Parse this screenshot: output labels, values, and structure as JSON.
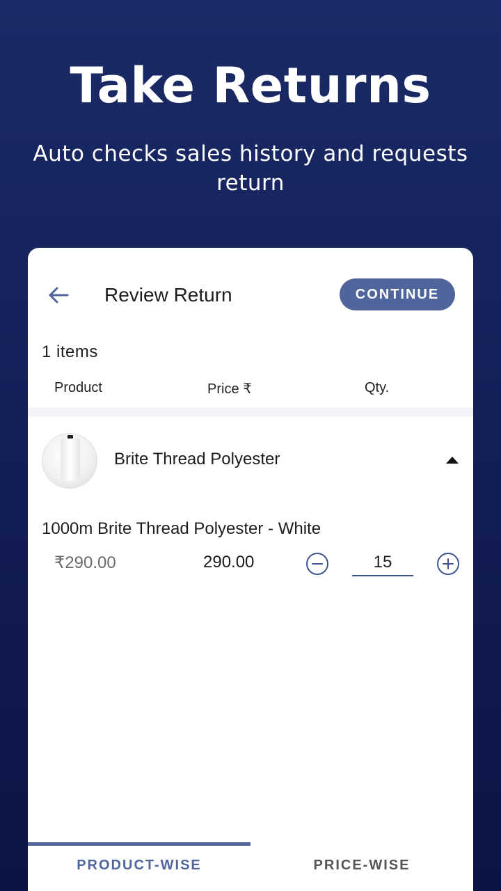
{
  "promo": {
    "title": "Take Returns",
    "subtitle": "Auto checks sales history and requests return"
  },
  "toolbar": {
    "back_icon": "arrow-left-icon",
    "title": "Review Return",
    "continue_label": "CONTINUE"
  },
  "summary": {
    "items_count": "1 items"
  },
  "columns": {
    "product": "Product",
    "price": "Price ₹",
    "qty": "Qty."
  },
  "product": {
    "name": "Brite Thread Polyester",
    "toggle_icon": "caret-up-icon",
    "variant": {
      "name": "1000m Brite Thread Polyester - White",
      "mrp": "₹290.00",
      "price": "290.00",
      "quantity": "15"
    }
  },
  "tabs": {
    "product_wise": "PRODUCT-WISE",
    "price_wise": "PRICE-WISE",
    "active": "product_wise"
  },
  "colors": {
    "accent": "#4f659c",
    "background_top": "#1b2a66",
    "background_bottom": "#0c1444"
  }
}
